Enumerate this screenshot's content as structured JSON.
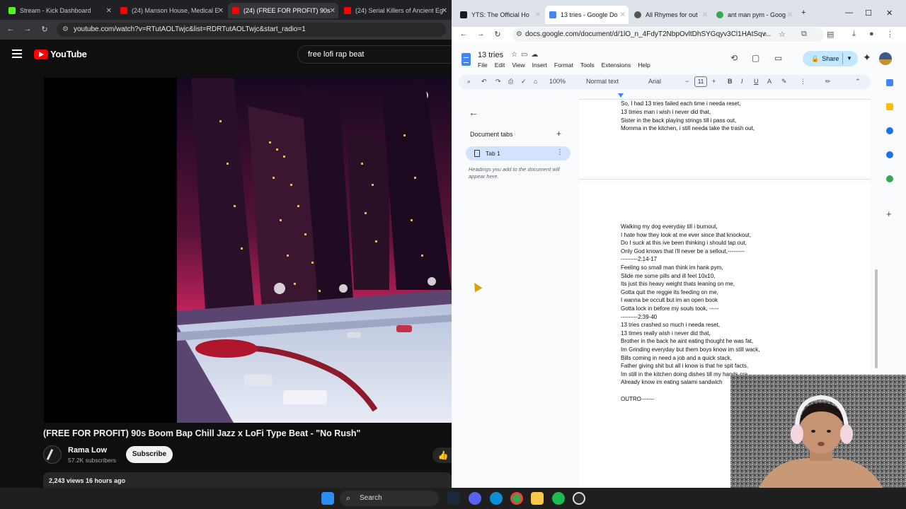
{
  "left_window": {
    "tabs": [
      {
        "title": "Stream - Kick Dashboard",
        "color": "#53fc18"
      },
      {
        "title": "(24) Manson House, Medical E",
        "color": "#ff0000"
      },
      {
        "title": "(24) (FREE FOR PROFIT) 90s",
        "color": "#ff0000"
      },
      {
        "title": "(24) Serial Killers of Ancient Eg",
        "color": "#ff0000"
      }
    ],
    "url": "youtube.com/watch?v=RTutAOLTwjc&list=RDRTutAOLTwjc&start_radio=1",
    "youtube": {
      "logo_text": "YouTube",
      "search_query": "free lofi rap beat",
      "video_title": "(FREE FOR PROFIT) 90s Boom Bap Chill Jazz x LoFi Type Beat - \"No Rush\"",
      "channel_name": "Rama Low",
      "subscribers": "57.2K subscribers",
      "subscribe_label": "Subscribe",
      "views_time": "2,243 views  16 hours ago"
    }
  },
  "right_window": {
    "tabs": [
      {
        "title": "YTS: The Official Ho",
        "color": "#1a1a1a"
      },
      {
        "title": "13 tries - Google Do",
        "color": "#4285f4"
      },
      {
        "title": "All Rhymes for out",
        "color": "#555555"
      },
      {
        "title": "ant man pym - Goog",
        "color": "#34a853"
      }
    ],
    "url": "docs.google.com/document/d/1lO_n_4FdyT2NbpOvltDhSYGqyv3Cl1HAtSqv...",
    "doc": {
      "title": "13 tries",
      "menu": [
        "File",
        "Edit",
        "View",
        "Insert",
        "Format",
        "Tools",
        "Extensions",
        "Help"
      ],
      "share_label": "Share",
      "zoom": "100%",
      "style": "Normal text",
      "font": "Arial",
      "font_size": "11",
      "outline": {
        "tabs_label": "Document tabs",
        "tab_name": "Tab 1",
        "hint": "Headings you add to the document will appear here."
      },
      "page1_lines": [
        "So, I had 13 tries failed each time i needa reset,",
        "13 times man i wish i never did that,",
        "Sister in the back playing strings till i pass out,",
        "Momma in the kitchen, i still needa take the trash out,"
      ],
      "page2_lines": [
        "Walking my dog everyday till i burnout,",
        "I hate how they look at me ever since that knockout,",
        "Do I suck at this ive been thinking i should tap out,",
        "Only God knows that i'll never be a sellout,---------",
        "---------2:14-17",
        "Feeling so small man think im hank pym,",
        "Slide me some pills and ill feel 10x10,",
        "Its just this heavy weight thats leaning on me,",
        "Gotta quit the reggie its feeding on me,",
        "I wanna be occult but im an open book",
        "Gotta lock in before my souls took, -----",
        "---------2:39-40",
        "13 tries crashed so much i needa reset,",
        "13 times really wish i never did that,",
        "Brother in the back he aint eating thought he was fat,",
        "Im Grinding everyday but them boys know im still wack,",
        "Bills coming in need a job and a quick stack,",
        "Father giving shit but all i know is that he spit facts,",
        "Im still in the kitchen doing dishes till my hands cra",
        "Already know im eating salami sandwich",
        "",
        "OUTRO-------"
      ]
    }
  },
  "taskbar": {
    "search_label": "Search"
  }
}
